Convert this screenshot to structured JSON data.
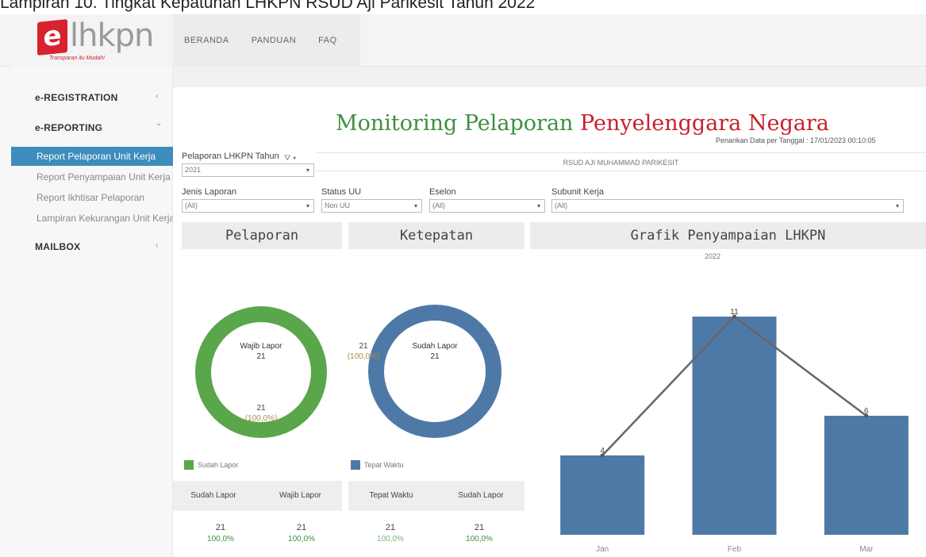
{
  "caption": "Lampiran 10. Tingkat Kepatuhan LHKPN RSUD Aji Parikesit Tahun 2022",
  "logo": {
    "letter": "e",
    "word": "lhkpn",
    "tagline": "Transparan itu Mudah!"
  },
  "nav": {
    "items": [
      "BERANDA",
      "PANDUAN",
      "FAQ"
    ]
  },
  "sidebar": {
    "sections": [
      {
        "label": "e-REGISTRATION",
        "chevron": "‹"
      },
      {
        "label": "e-REPORTING",
        "chevron": "⌄"
      },
      {
        "label": "MAILBOX",
        "chevron": "‹"
      }
    ],
    "items": [
      "Report Pelaporan Unit Kerja",
      "Report Penyampaian Unit Kerja",
      "Report Ikhtisar Pelaporan",
      "Lampiran Kekurangan Unit Kerja"
    ]
  },
  "dashboard": {
    "title_part1": "Monitoring Pelaporan",
    "title_part2": "Penyelenggara Negara",
    "data_date": "Penarikan Data per Tanggal : 17/01/2023 00:10:05",
    "unit_name": "RSUD AJI MUHAMMAD PARIKESIT"
  },
  "filters": {
    "tahun": {
      "label": "Pelaporan LHKPN Tahun",
      "value": "2021"
    },
    "jenis": {
      "label": "Jenis Laporan",
      "value": "(All)"
    },
    "status": {
      "label": "Status UU",
      "value": "Non UU"
    },
    "eselon": {
      "label": "Eselon",
      "value": "(All)"
    },
    "subunit": {
      "label": "Subunit Kerja",
      "value": "(All)"
    }
  },
  "panels": {
    "pelaporan": {
      "title": "Pelaporan",
      "center_label": "Wajib Lapor",
      "center_value": "21",
      "ring_value": "21",
      "ring_pct": "(100,0%)",
      "legend": "Sudah Lapor",
      "headers": [
        "Sudah Lapor",
        "Wajib Lapor"
      ],
      "values": [
        "21",
        "21"
      ],
      "pcts": [
        "100,0%",
        "100,0%"
      ]
    },
    "ketepatan": {
      "title": "Ketepatan",
      "center_label": "Sudah Lapor",
      "center_value": "21",
      "ring_value": "21",
      "ring_pct": "(100,0%)",
      "legend": "Tepat Waktu",
      "headers": [
        "Tepat Waktu",
        "Sudah Lapor"
      ],
      "values": [
        "21",
        "21"
      ],
      "pcts": [
        "100,0%",
        "100,0%"
      ]
    },
    "grafik": {
      "title": "Grafik Penyampaian LHKPN",
      "year": "2022"
    }
  },
  "colors": {
    "green": "#5aa64b",
    "blue": "#4e79a7",
    "title_green": "#3f8f3f",
    "title_red": "#c8202c",
    "sidebar_active": "#3c8dbc"
  },
  "chart_data": {
    "type": "bar",
    "title": "2022",
    "categories": [
      "Jan",
      "Feb",
      "Mar"
    ],
    "values": [
      4,
      11,
      6
    ],
    "overlay_line": [
      4,
      11,
      6
    ],
    "ylim": [
      0,
      12
    ],
    "grid": false,
    "bar_color": "#4e79a7",
    "line_color": "#666666"
  }
}
